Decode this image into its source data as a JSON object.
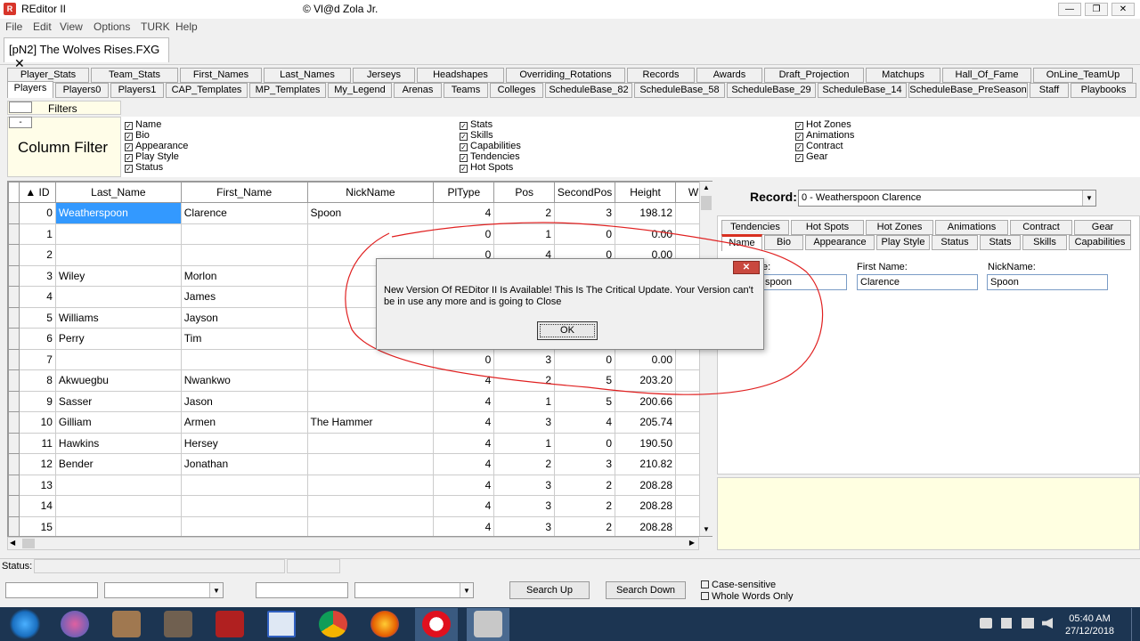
{
  "window": {
    "title": "REditor II",
    "copyright": "© Vl@d Zola Jr.",
    "min": "—",
    "max": "❐",
    "close": "✕"
  },
  "menu": [
    "File",
    "Edit",
    "View",
    "Options",
    "TURK",
    "Help"
  ],
  "doc_tab": {
    "label": "[pN2] The Wolves Rises.FXG",
    "close": "✕"
  },
  "tabs_row1": [
    "Player_Stats",
    "Team_Stats",
    "First_Names",
    "Last_Names",
    "Jerseys",
    "Headshapes",
    "Overriding_Rotations",
    "Records",
    "Awards",
    "Draft_Projection",
    "Matchups",
    "Hall_Of_Fame",
    "OnLine_TeamUp"
  ],
  "tabs_row2": [
    "Players",
    "Players0",
    "Players1",
    "CAP_Templates",
    "MP_Templates",
    "My_Legend",
    "Arenas",
    "Teams",
    "Colleges",
    "ScheduleBase_82",
    "ScheduleBase_58",
    "ScheduleBase_29",
    "ScheduleBase_14",
    "ScheduleBase_PreSeason",
    "Staff",
    "Playbooks"
  ],
  "filters": {
    "label": "Filters",
    "collapse": "-",
    "column_filter": "Column Filter",
    "col1": [
      "Name",
      "Bio",
      "Appearance",
      "Play Style",
      "Status"
    ],
    "col2": [
      "Stats",
      "Skills",
      "Capabilities",
      "Tendencies",
      "Hot Spots"
    ],
    "col3": [
      "Hot Zones",
      "Animations",
      "Contract",
      "Gear"
    ]
  },
  "grid": {
    "columns": [
      "▲ ID",
      "Last_Name",
      "First_Name",
      "NickName",
      "PlType",
      "Pos",
      "SecondPos",
      "Height",
      "W"
    ],
    "rows": [
      [
        "0",
        "Weatherspoon",
        "Clarence",
        "Spoon",
        "4",
        "2",
        "3",
        "198.12"
      ],
      [
        "1",
        "",
        "",
        "",
        "0",
        "1",
        "0",
        "0.00"
      ],
      [
        "2",
        "",
        "",
        "",
        "0",
        "4",
        "0",
        "0.00"
      ],
      [
        "3",
        "Wiley",
        "Morlon",
        "",
        "",
        "",
        "",
        ""
      ],
      [
        "4",
        "",
        "James",
        "",
        "",
        "",
        "",
        ""
      ],
      [
        "5",
        "Williams",
        "Jayson",
        "",
        "",
        "",
        "",
        ""
      ],
      [
        "6",
        "Perry",
        "Tim",
        "",
        "",
        "",
        "",
        ""
      ],
      [
        "7",
        "",
        "",
        "",
        "0",
        "3",
        "0",
        "0.00"
      ],
      [
        "8",
        "Akwuegbu",
        "Nwankwo",
        "",
        "4",
        "2",
        "5",
        "203.20"
      ],
      [
        "9",
        "Sasser",
        "Jason",
        "",
        "4",
        "1",
        "5",
        "200.66"
      ],
      [
        "10",
        "Gilliam",
        "Armen",
        "The Hammer",
        "4",
        "3",
        "4",
        "205.74"
      ],
      [
        "11",
        "Hawkins",
        "Hersey",
        "",
        "4",
        "1",
        "0",
        "190.50"
      ],
      [
        "12",
        "Bender",
        "Jonathan",
        "",
        "4",
        "2",
        "3",
        "210.82"
      ],
      [
        "13",
        "",
        "",
        "",
        "4",
        "3",
        "2",
        "208.28"
      ],
      [
        "14",
        "",
        "",
        "",
        "4",
        "3",
        "2",
        "208.28"
      ],
      [
        "15",
        "",
        "",
        "",
        "4",
        "3",
        "2",
        "208.28"
      ]
    ]
  },
  "record": {
    "label": "Record:",
    "value": "0 - Weatherspoon Clarence"
  },
  "detail_tabs_row1": [
    "Tendencies",
    "Hot Spots",
    "Hot Zones",
    "Animations",
    "Contract",
    "Gear"
  ],
  "detail_tabs_row2": [
    "Name",
    "Bio",
    "Appearance",
    "Play Style",
    "Status",
    "Stats",
    "Skills",
    "Capabilities"
  ],
  "name_fields": {
    "last_label": "e:",
    "last_value": "spoon",
    "first_label": "First Name:",
    "first_value": "Clarence",
    "nick_label": "NickName:",
    "nick_value": "Spoon"
  },
  "status": {
    "label": "Status:"
  },
  "search": {
    "up": "Search Up",
    "down": "Search Down",
    "case": "Case-sensitive",
    "whole": "Whole Words Only"
  },
  "dialog": {
    "close": "✕",
    "message": "New Version Of REDitor II Is Available! This Is The Critical Update. Your Version can't be in use any more and is going to Close",
    "ok": "OK"
  },
  "taskbar": {
    "time": "05:40 AM",
    "date": "27/12/2018"
  },
  "colors": {
    "accent": "#3399ff",
    "annotation": "#e02020",
    "taskbar": "#1c3552"
  }
}
